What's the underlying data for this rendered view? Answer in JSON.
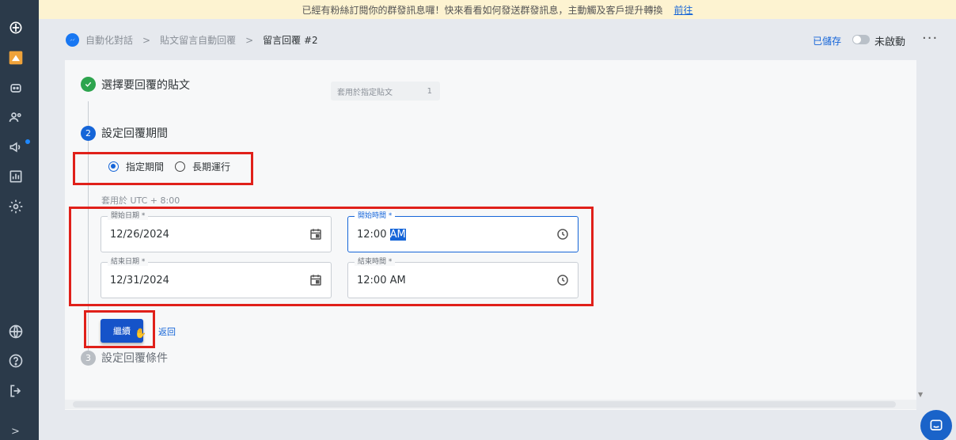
{
  "banner": {
    "message": "已經有粉絲訂閱你的群發訊息囉！快來看看如何發送群發訊息，主動觸及客戶提升轉換",
    "link": "前往"
  },
  "breadcrumb": {
    "items": [
      "自動化對話",
      "貼文留言自動回覆",
      "留言回覆 #2"
    ],
    "separator": ">"
  },
  "header": {
    "saved_status": "已儲存",
    "toggle_label": "未啟動",
    "more_menu": "···"
  },
  "steps": {
    "step1": {
      "title": "選擇要回覆的貼文",
      "status": "done",
      "chip_label": "套用於指定貼文",
      "chip_count": "1"
    },
    "step2": {
      "number": "2",
      "title": "設定回覆期間"
    },
    "step3": {
      "number": "3",
      "title": "設定回覆條件"
    }
  },
  "period": {
    "options": [
      "指定期間",
      "長期運行"
    ],
    "selected": "指定期間",
    "timezone": "套用於 UTC + 8:00"
  },
  "fields": {
    "start_date": {
      "label": "開始日期 *",
      "value": "12/26/2024"
    },
    "start_time": {
      "label": "開始時間 *",
      "value_main": "12:00 ",
      "value_highlight": "AM"
    },
    "end_date": {
      "label": "結束日期 *",
      "value": "12/31/2024"
    },
    "end_time": {
      "label": "結束時間 *",
      "value": "12:00 AM"
    }
  },
  "actions": {
    "continue": "繼續",
    "back": "返回"
  },
  "colors": {
    "primary": "#1565d8",
    "annotation": "#e0201a",
    "sidebar": "#2b3a4a",
    "banner": "#fdf3d1",
    "success": "#2da44e"
  }
}
